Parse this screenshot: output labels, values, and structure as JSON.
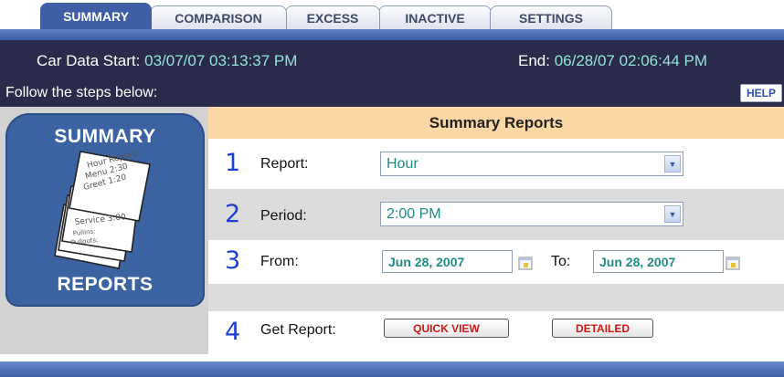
{
  "tabs": [
    {
      "label": "SUMMARY",
      "active": true
    },
    {
      "label": "COMPARISON",
      "active": false
    },
    {
      "label": "EXCESS",
      "active": false
    },
    {
      "label": "INACTIVE",
      "active": false
    },
    {
      "label": "SETTINGS",
      "active": false
    }
  ],
  "range": {
    "start_label": "Car Data Start: ",
    "start_value": "03/07/07 03:13:37 PM",
    "end_label": "End: ",
    "end_value": "06/28/07 02:06:44 PM"
  },
  "steps_text": "Follow the steps below:",
  "help_label": "HELP",
  "badge": {
    "top": "SUMMARY",
    "bottom": "REPORTS",
    "paper_lines": [
      "Hour Report:",
      "Menu 2:30",
      "Greet 1:20",
      "Service 3:00",
      "Pullins:",
      "Pullouts:"
    ]
  },
  "form": {
    "title": "Summary Reports",
    "step1": {
      "num": "1",
      "label": "Report:",
      "value": "Hour"
    },
    "step2": {
      "num": "2",
      "label": "Period:",
      "value": "2:00 PM"
    },
    "step3": {
      "num": "3",
      "label": "From:",
      "from_value": "Jun 28, 2007",
      "to_label": "To:",
      "to_value": "Jun 28, 2007"
    },
    "step4": {
      "num": "4",
      "label": "Get Report:",
      "quick_view": "QUICK VIEW",
      "detailed": "DETAILED"
    }
  },
  "colors": {
    "tab_active": "#3f5ea5",
    "header_dark": "#2a2a4a",
    "range_value": "#8fe6d8",
    "form_title_bg": "#fbd7a6",
    "step_number": "#1d3fd2",
    "field_text": "#1f8b83",
    "button_text": "#d01515"
  }
}
